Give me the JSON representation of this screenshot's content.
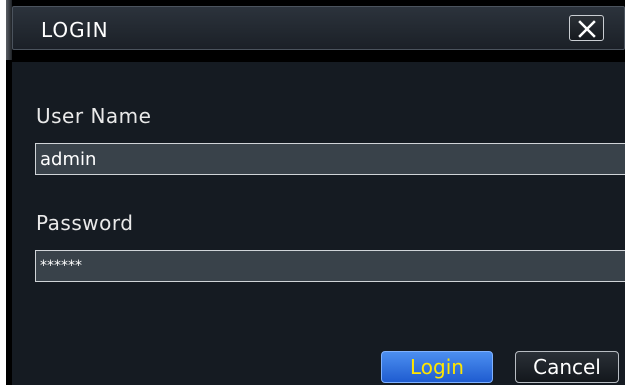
{
  "dialog": {
    "title": "LOGIN"
  },
  "form": {
    "username_label": "User Name",
    "username_value": "admin",
    "password_label": "Password",
    "password_value": "******"
  },
  "buttons": {
    "login": "Login",
    "cancel": "Cancel"
  },
  "icons": {
    "close": "close-icon"
  },
  "colors": {
    "login_text": "#ffe600",
    "login_bg": "#2f6fe0",
    "panel_bg": "#151b22",
    "input_bg": "#39424a"
  }
}
